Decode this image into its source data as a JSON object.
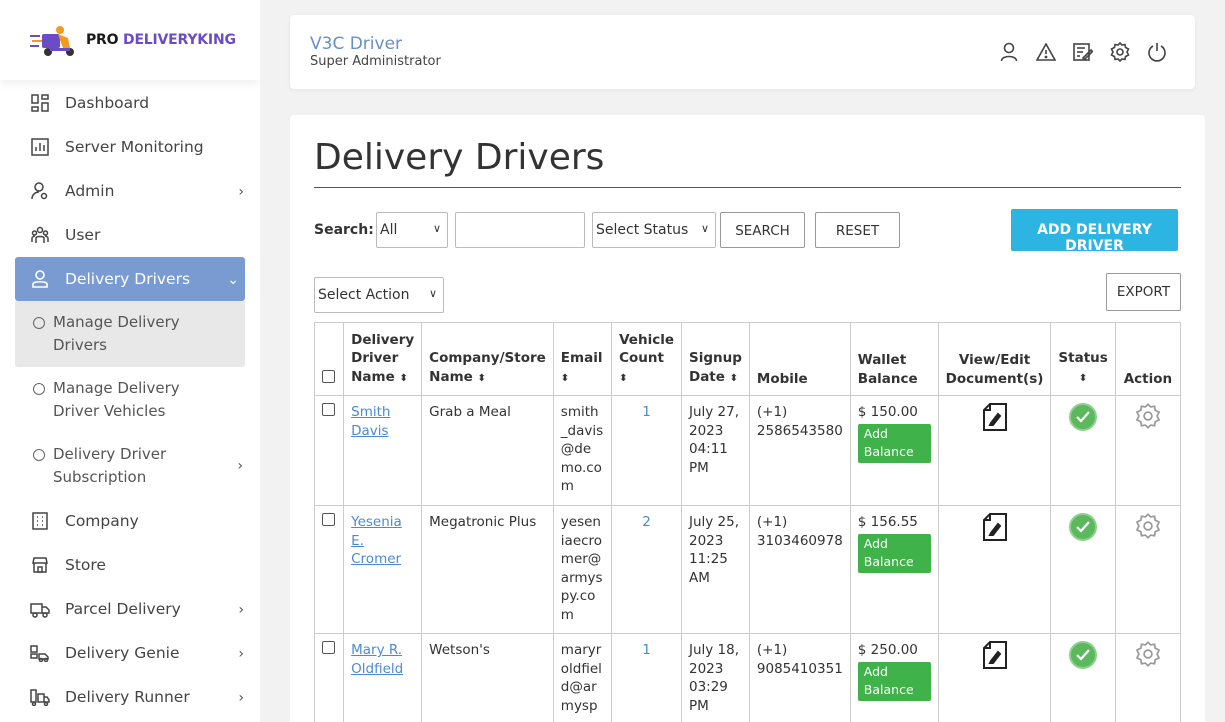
{
  "brand": {
    "part1": "PRO",
    "part2": " DELIVERYKING"
  },
  "sidebar": {
    "items": [
      {
        "label": "Dashboard",
        "icon": "dashboard-icon"
      },
      {
        "label": "Server Monitoring",
        "icon": "chart-icon"
      },
      {
        "label": "Admin",
        "icon": "admin-icon"
      },
      {
        "label": "User",
        "icon": "users-icon"
      },
      {
        "label": "Delivery Drivers",
        "icon": "driver-icon"
      },
      {
        "label": "Company",
        "icon": "building-icon"
      },
      {
        "label": "Store",
        "icon": "store-icon"
      },
      {
        "label": "Parcel Delivery",
        "icon": "truck-icon"
      },
      {
        "label": "Delivery Genie",
        "icon": "genie-icon"
      },
      {
        "label": "Delivery Runner",
        "icon": "runner-icon"
      }
    ],
    "sub_items": [
      {
        "label": "Manage Delivery Drivers"
      },
      {
        "label": "Manage Delivery Driver Vehicles"
      },
      {
        "label": "Delivery Driver Subscription"
      }
    ]
  },
  "header": {
    "title": "V3C Driver",
    "subtitle": "Super Administrator"
  },
  "page": {
    "title": "Delivery Drivers"
  },
  "search": {
    "label": "Search:",
    "field_value": "All",
    "query": "",
    "status_value": "Select Status",
    "search_button": "SEARCH",
    "reset_button": "RESET",
    "add_button": "ADD DELIVERY DRIVER",
    "action_value": "Select Action",
    "export_button": "EXPORT"
  },
  "table": {
    "headers": {
      "name": "Delivery Driver Name",
      "company": "Company/Store Name",
      "email": "Email",
      "vehicle": "Vehicle Count",
      "signup": "Signup Date",
      "mobile": "Mobile",
      "wallet": "Wallet Balance",
      "docs": "View/Edit Document(s)",
      "status": "Status",
      "action": "Action"
    },
    "add_balance_label": "Add Balance",
    "rows": [
      {
        "name": "Smith Davis",
        "company": "Grab a Meal",
        "email": "smith_davis@demo.com",
        "vehicles": "1",
        "signup": "July 27, 2023 04:11 PM",
        "mobile": "(+1) 2586543580",
        "wallet": "$ 150.00"
      },
      {
        "name": "Yesenia E. Cromer",
        "company": "Megatronic Plus",
        "email": "yeseniaecromer@armyspy.com",
        "vehicles": "2",
        "signup": "July 25, 2023 11:25 AM",
        "mobile": "(+1) 3103460978",
        "wallet": "$ 156.55"
      },
      {
        "name": "Mary R. Oldfield",
        "company": "Wetson's",
        "email": "maryroldfield@armysp",
        "vehicles": "1",
        "signup": "July 18, 2023 03:29 PM",
        "mobile": "(+1) 9085410351",
        "wallet": "$ 250.00"
      }
    ]
  }
}
